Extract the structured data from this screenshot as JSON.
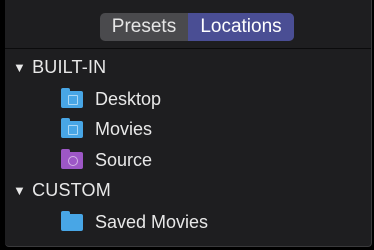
{
  "tabs": {
    "presets": "Presets",
    "locations": "Locations"
  },
  "groups": [
    {
      "label": "BUILT-IN",
      "items": [
        {
          "label": "Desktop"
        },
        {
          "label": "Movies"
        },
        {
          "label": "Source"
        }
      ]
    },
    {
      "label": "CUSTOM",
      "items": [
        {
          "label": "Saved Movies"
        }
      ]
    }
  ],
  "colors": {
    "accent": "#4a4e94",
    "folder": "#48a6e6",
    "source_folder": "#9d57c6"
  },
  "triangle": "▼"
}
